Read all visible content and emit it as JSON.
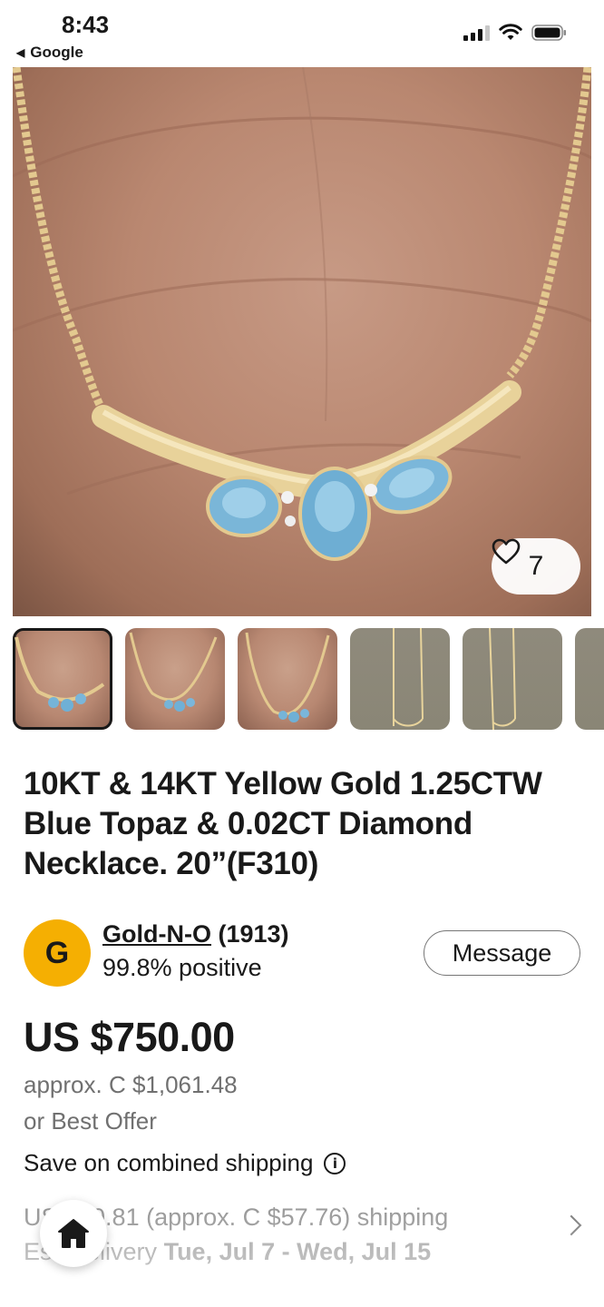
{
  "status_bar": {
    "time": "8:43",
    "back_app": "Google",
    "icons": [
      "cellular-signal-icon",
      "wifi-icon",
      "battery-icon"
    ]
  },
  "hero": {
    "favorite_count": "7",
    "favorite_icon": "heart-outline-icon"
  },
  "thumbnails": [
    {
      "kind": "hand",
      "active": true
    },
    {
      "kind": "hand",
      "active": false
    },
    {
      "kind": "hand",
      "active": false
    },
    {
      "kind": "chain",
      "active": false
    },
    {
      "kind": "chain",
      "active": false
    },
    {
      "kind": "chain",
      "active": false
    }
  ],
  "listing": {
    "title": "10KT & 14KT Yellow Gold 1.25CTW Blue Topaz & 0.02CT Diamond Necklace. 20”(F310)"
  },
  "seller": {
    "avatar_letter": "G",
    "avatar_color": "#f5af02",
    "name": "Gold-N-O",
    "score": "(1913)",
    "positive": "99.8% positive",
    "message_label": "Message"
  },
  "price": {
    "amount": "US $750.00",
    "approx": "approx. C $1,061.48",
    "offer": "or Best Offer",
    "combined_shipping": "Save on combined shipping",
    "combined_icon": "info-icon"
  },
  "shipping": {
    "cost_line": "US $40.81 (approx. C $57.76) shipping",
    "delivery_prefix": "Est. delivery",
    "delivery_dates": "Tue, Jul 7 - Wed, Jul 15"
  },
  "nav": {
    "home_icon": "home-icon",
    "chevron_icon": "chevron-right-icon"
  }
}
